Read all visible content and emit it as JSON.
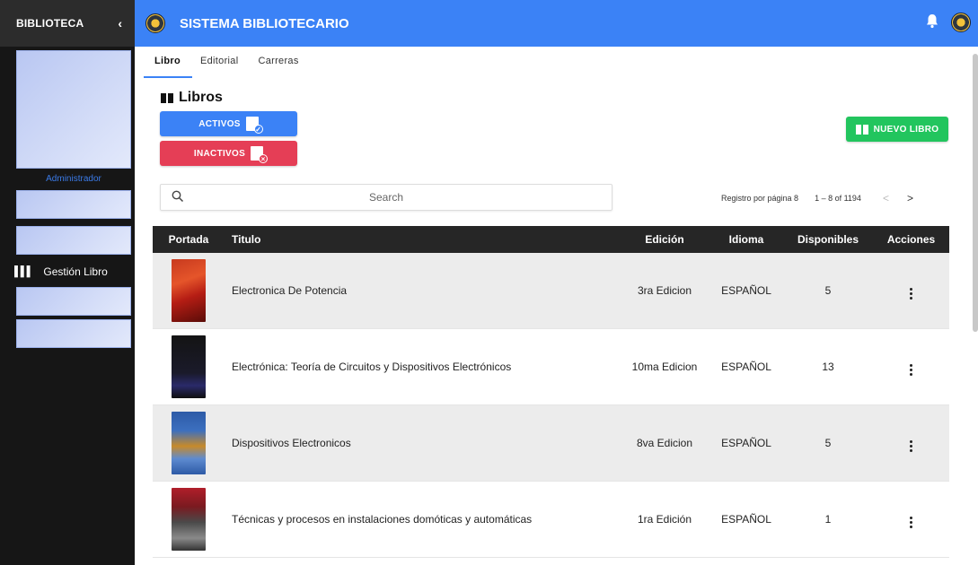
{
  "sidebar": {
    "title": "BIBLIOTECA",
    "collapse_icon": "‹",
    "role": "Administrador",
    "menu_item": "Gestión Libro"
  },
  "topbar": {
    "title": "SISTEMA BIBLIOTECARIO"
  },
  "tabs": [
    "Libro",
    "Editorial",
    "Carreras"
  ],
  "page": {
    "title": "Libros",
    "btn_activos": "ACTIVOS",
    "btn_inactivos": "INACTIVOS",
    "btn_nuevo": "NUEVO LIBRO"
  },
  "search": {
    "placeholder": "Search"
  },
  "pager": {
    "label": "Registro por página 8",
    "range": "1 – 8 of 1194"
  },
  "table": {
    "headers": [
      "Portada",
      "Titulo",
      "Edición",
      "Idioma",
      "Disponibles",
      "Acciones"
    ],
    "rows": [
      {
        "titulo": "Electronica De Potencia",
        "edicion": "3ra Edicion",
        "idioma": "ESPAÑOL",
        "disponibles": "5"
      },
      {
        "titulo": "Electrónica: Teoría de Circuitos y Dispositivos Electrónicos",
        "edicion": "10ma Edicion",
        "idioma": "ESPAÑOL",
        "disponibles": "13"
      },
      {
        "titulo": "Dispositivos Electronicos",
        "edicion": "8va Edicion",
        "idioma": "ESPAÑOL",
        "disponibles": "5"
      },
      {
        "titulo": "Técnicas y procesos en instalaciones domóticas y automáticas",
        "edicion": "1ra Edición",
        "idioma": "ESPAÑOL",
        "disponibles": "1"
      }
    ]
  },
  "colors": {
    "primary": "#3b82f6",
    "danger": "#e53e56",
    "success": "#22c55e",
    "sidebar": "#161616",
    "table_header": "#262626"
  },
  "icons": [
    "collapse-chevron-icon",
    "app-logo-icon",
    "bell-icon",
    "avatar-icon",
    "book-icon",
    "document-check-icon",
    "document-x-icon",
    "search-icon",
    "chevron-left-icon",
    "chevron-right-icon",
    "more-vert-icon",
    "library-icon"
  ]
}
